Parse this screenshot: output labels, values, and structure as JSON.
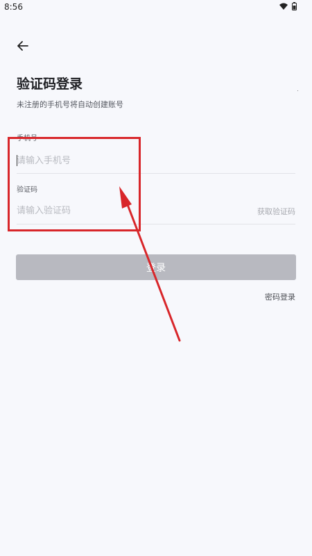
{
  "status_bar": {
    "time": "8:56",
    "icons": [
      "wifi-icon",
      "battery-icon"
    ]
  },
  "header": {
    "back_icon": "arrow-left-icon",
    "title": "验证码登录",
    "subtitle": "未注册的手机号将自动创建账号"
  },
  "form": {
    "phone": {
      "label": "手机号",
      "value": "",
      "placeholder": "请输入手机号"
    },
    "code": {
      "label": "验证码",
      "value": "",
      "placeholder": "请输入验证码",
      "get_code_label": "获取验证码"
    },
    "login_label": "登录",
    "password_login_label": "密码登录"
  },
  "annotation": {
    "color": "#d8262a"
  },
  "colors": {
    "background": "#f7f8fc",
    "button_disabled": "#b8b9c0",
    "text_primary": "#1f2024"
  }
}
